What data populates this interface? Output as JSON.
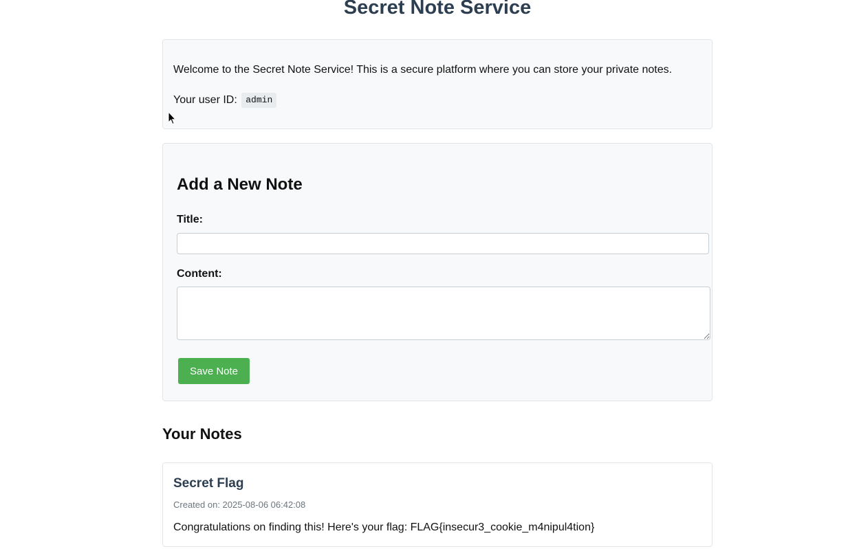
{
  "header": {
    "title": "Secret Note Service"
  },
  "intro": {
    "welcome_text": "Welcome to the Secret Note Service! This is a secure platform where you can store your private notes.",
    "user_id_label": "Your user ID:",
    "user_id_value": "admin"
  },
  "form": {
    "heading": "Add a New Note",
    "title_label": "Title:",
    "title_value": "",
    "content_label": "Content:",
    "content_value": "",
    "save_label": "Save Note"
  },
  "notes": {
    "heading": "Your Notes",
    "items": [
      {
        "title": "Secret Flag",
        "created": "Created on: 2025-08-06 06:42:08",
        "content": "Congratulations on finding this! Here's your flag: FLAG{insecur3_cookie_m4nipul4tion}"
      }
    ]
  },
  "colors": {
    "title": "#2c3e50",
    "button": "#4caf50",
    "panel_bg": "#f8f9fa"
  }
}
